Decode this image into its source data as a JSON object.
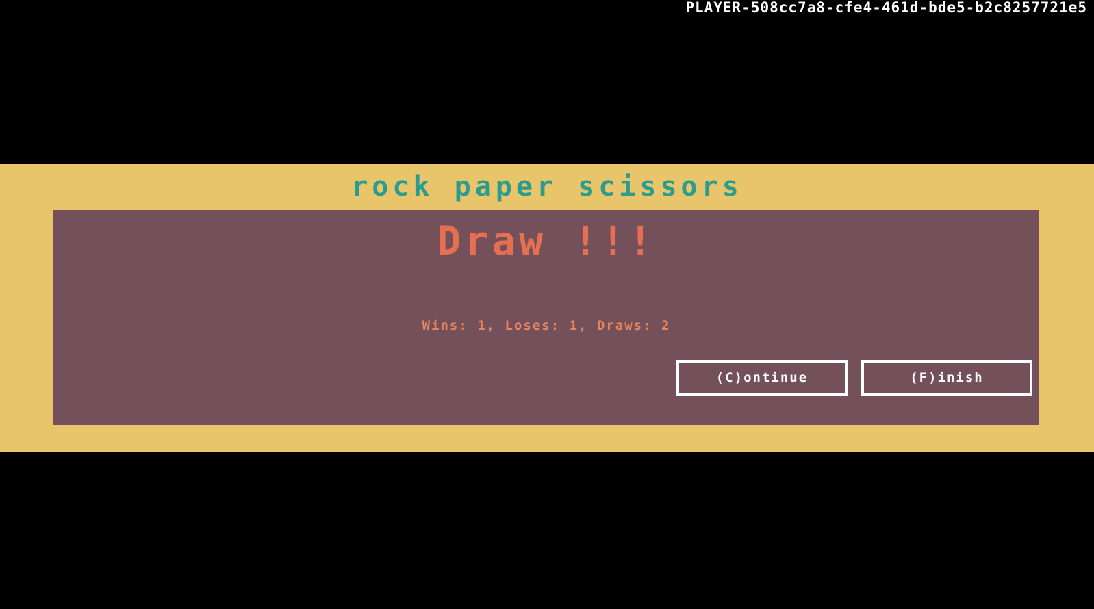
{
  "header": {
    "player_id": "PLAYER-508cc7a8-cfe4-461d-bde5-b2c8257721e5"
  },
  "game": {
    "title": "rock paper scissors",
    "result": "Draw !!!",
    "score_text": "Wins: 1, Loses: 1, Draws: 2"
  },
  "actions": {
    "continue_label": "(C)ontinue",
    "finish_label": "(F)inish"
  },
  "colors": {
    "background": "#000000",
    "band": "#e8c46b",
    "panel": "#73505a",
    "title": "#2a9d8f",
    "result": "#e76f51",
    "score": "#e9855c",
    "button_border": "#ffffff"
  }
}
